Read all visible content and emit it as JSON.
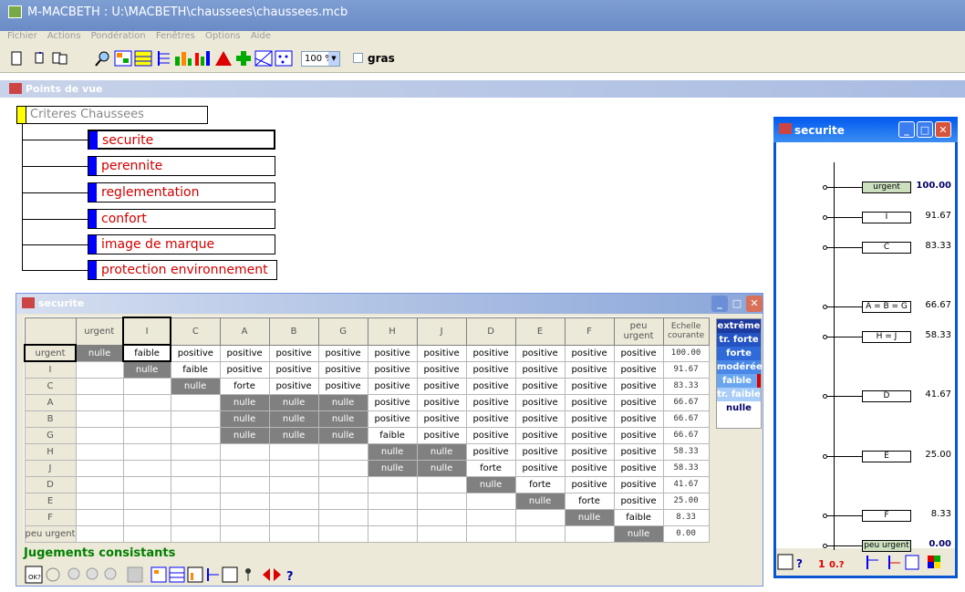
{
  "window": {
    "title": "M-MACBETH : U:\\MACBETH\\chaussees\\chaussees.mcb"
  },
  "menu": [
    "Fichier",
    "Actions",
    "Pondération",
    "Fenêtres",
    "Options",
    "Aide"
  ],
  "toolbar": {
    "zoom": "100 %",
    "gras": "gras"
  },
  "points_de_vue": {
    "title": "Points de vue",
    "root": "Criteres Chaussees",
    "nodes": [
      "securite",
      "perennite",
      "reglementation",
      "confort",
      "image de marque",
      "protection environnement"
    ]
  },
  "matrix": {
    "title": "securite",
    "columns": [
      "urgent",
      "I",
      "C",
      "A",
      "B",
      "G",
      "H",
      "J",
      "D",
      "E",
      "F",
      "peu urgent"
    ],
    "echelle_header": "Echelle courante",
    "rows": [
      {
        "label": "urgent",
        "cells": [
          "nulle",
          "faible",
          "positive",
          "positive",
          "positive",
          "positive",
          "positive",
          "positive",
          "positive",
          "positive",
          "positive",
          "positive"
        ],
        "score": "100.00"
      },
      {
        "label": "I",
        "cells": [
          "",
          "nulle",
          "faible",
          "positive",
          "positive",
          "positive",
          "positive",
          "positive",
          "positive",
          "positive",
          "positive",
          "positive"
        ],
        "score": "91.67"
      },
      {
        "label": "C",
        "cells": [
          "",
          "",
          "nulle",
          "forte",
          "positive",
          "positive",
          "positive",
          "positive",
          "positive",
          "positive",
          "positive",
          "positive"
        ],
        "score": "83.33"
      },
      {
        "label": "A",
        "cells": [
          "",
          "",
          "",
          "nulle",
          "nulle",
          "nulle",
          "positive",
          "positive",
          "positive",
          "positive",
          "positive",
          "positive"
        ],
        "score": "66.67"
      },
      {
        "label": "B",
        "cells": [
          "",
          "",
          "",
          "nulle",
          "nulle",
          "nulle",
          "positive",
          "positive",
          "positive",
          "positive",
          "positive",
          "positive"
        ],
        "score": "66.67"
      },
      {
        "label": "G",
        "cells": [
          "",
          "",
          "",
          "nulle",
          "nulle",
          "nulle",
          "faible",
          "positive",
          "positive",
          "positive",
          "positive",
          "positive"
        ],
        "score": "66.67"
      },
      {
        "label": "H",
        "cells": [
          "",
          "",
          "",
          "",
          "",
          "",
          "nulle",
          "nulle",
          "positive",
          "positive",
          "positive",
          "positive"
        ],
        "score": "58.33"
      },
      {
        "label": "J",
        "cells": [
          "",
          "",
          "",
          "",
          "",
          "",
          "nulle",
          "nulle",
          "forte",
          "positive",
          "positive",
          "positive"
        ],
        "score": "58.33"
      },
      {
        "label": "D",
        "cells": [
          "",
          "",
          "",
          "",
          "",
          "",
          "",
          "",
          "nulle",
          "forte",
          "positive",
          "positive"
        ],
        "score": "41.67"
      },
      {
        "label": "E",
        "cells": [
          "",
          "",
          "",
          "",
          "",
          "",
          "",
          "",
          "",
          "nulle",
          "forte",
          "positive"
        ],
        "score": "25.00"
      },
      {
        "label": "F",
        "cells": [
          "",
          "",
          "",
          "",
          "",
          "",
          "",
          "",
          "",
          "",
          "nulle",
          "faible"
        ],
        "score": "8.33"
      },
      {
        "label": "peu urgent",
        "cells": [
          "",
          "",
          "",
          "",
          "",
          "",
          "",
          "",
          "",
          "",
          "",
          "nulle"
        ],
        "score": "0.00"
      }
    ],
    "scale": [
      {
        "label": "extrême",
        "color": "#1c3aa0"
      },
      {
        "label": "tr. forte",
        "color": "#2454c2"
      },
      {
        "label": "forte",
        "color": "#2f6ad8"
      },
      {
        "label": "modérée",
        "color": "#4a87e6"
      },
      {
        "label": "faible",
        "color": "#6aa6f0"
      },
      {
        "label": "tr. faible",
        "color": "#a8cdf8"
      },
      {
        "label": "nulle",
        "color": "#ffffff"
      }
    ],
    "status": "Jugements consistants"
  },
  "side": {
    "title": "securite",
    "items": [
      {
        "label": "urgent",
        "value": "100.00"
      },
      {
        "label": "I",
        "value": "91.67"
      },
      {
        "label": "C",
        "value": "83.33"
      },
      {
        "label": "A = B = G",
        "value": "66.67"
      },
      {
        "label": "H = J",
        "value": "58.33"
      },
      {
        "label": "D",
        "value": "41.67"
      },
      {
        "label": "E",
        "value": "25.00"
      },
      {
        "label": "F",
        "value": "8.33"
      },
      {
        "label": "peu urgent",
        "value": "0.00"
      }
    ],
    "toolbar": {
      "one": "1",
      "zero_q": "0.?"
    }
  }
}
